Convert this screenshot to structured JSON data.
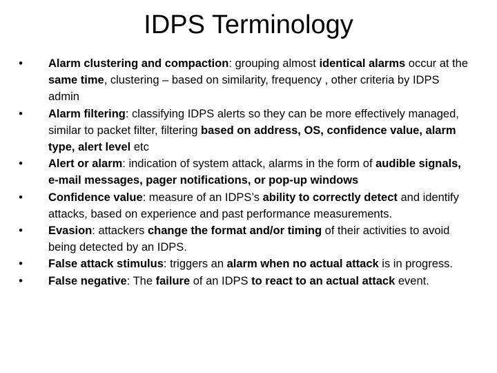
{
  "title": "IDPS Terminology",
  "bullet_glyph": "•",
  "items": [
    {
      "segments": [
        {
          "text": "Alarm clustering and compaction",
          "bold": true
        },
        {
          "text": ": grouping almost ",
          "bold": false
        },
        {
          "text": "identical alarms",
          "bold": true
        },
        {
          "text": " occur at the ",
          "bold": false
        },
        {
          "text": "same time",
          "bold": true
        },
        {
          "text": ", clustering – based on similarity, frequency , other criteria by IDPS admin",
          "bold": false
        }
      ]
    },
    {
      "segments": [
        {
          "text": "Alarm filtering",
          "bold": true
        },
        {
          "text": ": classifying IDPS alerts so they can be more effectively managed, similar to packet filter, filtering ",
          "bold": false
        },
        {
          "text": "based on address, OS, confidence value, alarm type, alert level",
          "bold": true
        },
        {
          "text": " etc",
          "bold": false
        }
      ]
    },
    {
      "segments": [
        {
          "text": "Alert or alarm",
          "bold": true
        },
        {
          "text": ": indication of system attack,  alarms in  the form of ",
          "bold": false
        },
        {
          "text": "audible signals, e-mail messages, pager notifications, or pop-up windows",
          "bold": true
        }
      ]
    },
    {
      "segments": [
        {
          "text": "Confidence value",
          "bold": true
        },
        {
          "text": ": measure of an IDPS’s ",
          "bold": false
        },
        {
          "text": "ability to correctly detect",
          "bold": true
        },
        {
          "text": " and identify attacks, based on experience and past performance measurements.",
          "bold": false
        }
      ]
    },
    {
      "segments": [
        {
          "text": "Evasion",
          "bold": true
        },
        {
          "text": ": attackers ",
          "bold": false
        },
        {
          "text": "change the format and/or timing",
          "bold": true
        },
        {
          "text": " of their activities to avoid being detected by an IDPS.",
          "bold": false
        }
      ]
    },
    {
      "segments": [
        {
          "text": "False attack stimulus",
          "bold": true
        },
        {
          "text": ": triggers an ",
          "bold": false
        },
        {
          "text": "alarm when no actual attack",
          "bold": true
        },
        {
          "text": " is in progress.",
          "bold": false
        }
      ]
    },
    {
      "segments": [
        {
          "text": "False negative",
          "bold": true
        },
        {
          "text": ": The ",
          "bold": false
        },
        {
          "text": "failure",
          "bold": true
        },
        {
          "text": " of an IDPS ",
          "bold": false
        },
        {
          "text": "to react to an actual attack",
          "bold": true
        },
        {
          "text": " event.",
          "bold": false
        }
      ]
    }
  ]
}
